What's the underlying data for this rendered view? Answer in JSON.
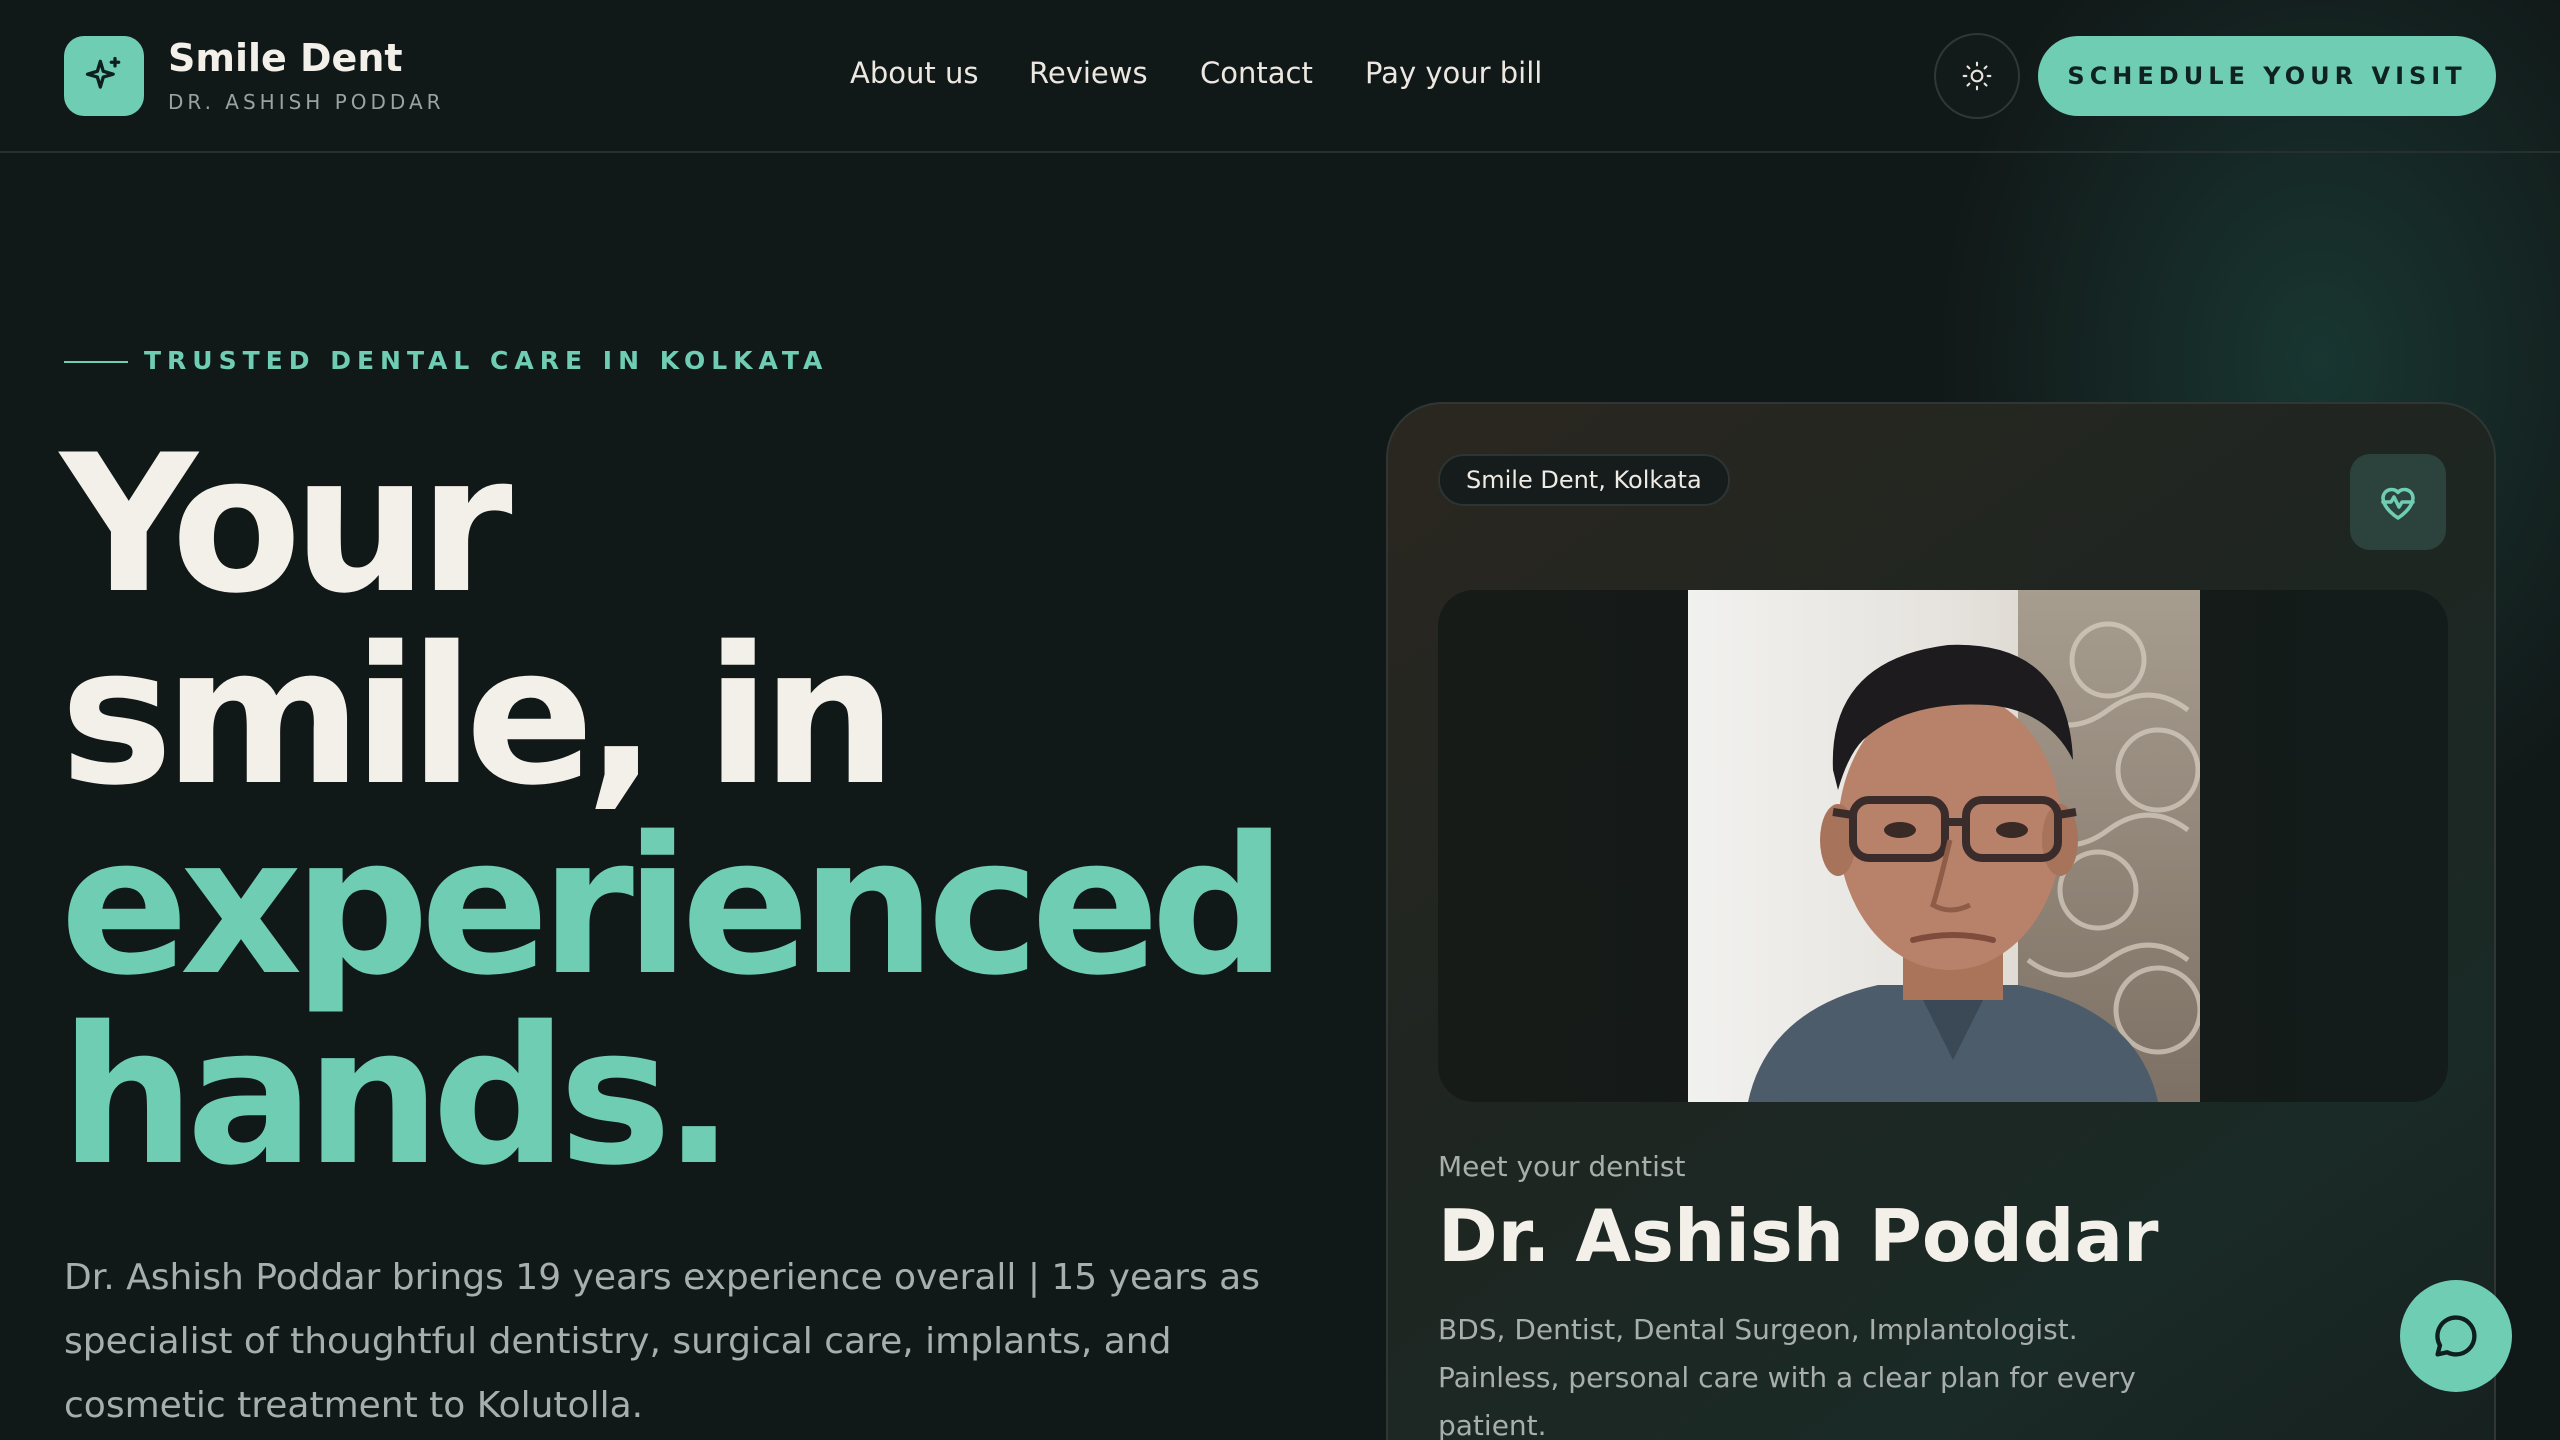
{
  "header": {
    "brand_name": "Smile Dent",
    "brand_sub": "DR. ASHISH PODDAR",
    "nav": [
      {
        "label": "About us"
      },
      {
        "label": "Reviews"
      },
      {
        "label": "Contact"
      },
      {
        "label": "Pay your bill"
      }
    ],
    "cta_label": "SCHEDULE YOUR VISIT",
    "logo_icon": "sparkle-icon",
    "theme_icon": "sun-icon"
  },
  "hero": {
    "eyebrow": "TRUSTED DENTAL CARE IN KOLKATA",
    "headline_lines": [
      "Your",
      "smile, in",
      "experienced",
      "hands."
    ],
    "paragraph": "Dr. Ashish Poddar brings 19 years experience overall | 15 years as specialist of thoughtful dentistry, surgical care, implants, and cosmetic treatment to Kolutolla."
  },
  "card": {
    "pill": "Smile Dent, Kolkata",
    "heart_icon": "heart-pulse-icon",
    "meet_label": "Meet your dentist",
    "doctor_name": "Dr. Ashish Poddar",
    "description": "BDS, Dentist, Dental Surgeon, Implantologist. Painless, personal care with a clear plan for every patient."
  },
  "chat": {
    "icon": "chat-bubble-icon"
  },
  "colors": {
    "background": "#111818",
    "accent": "#6fcdb3",
    "text_primary": "#f3efe9",
    "text_muted": "#a7aeab"
  }
}
